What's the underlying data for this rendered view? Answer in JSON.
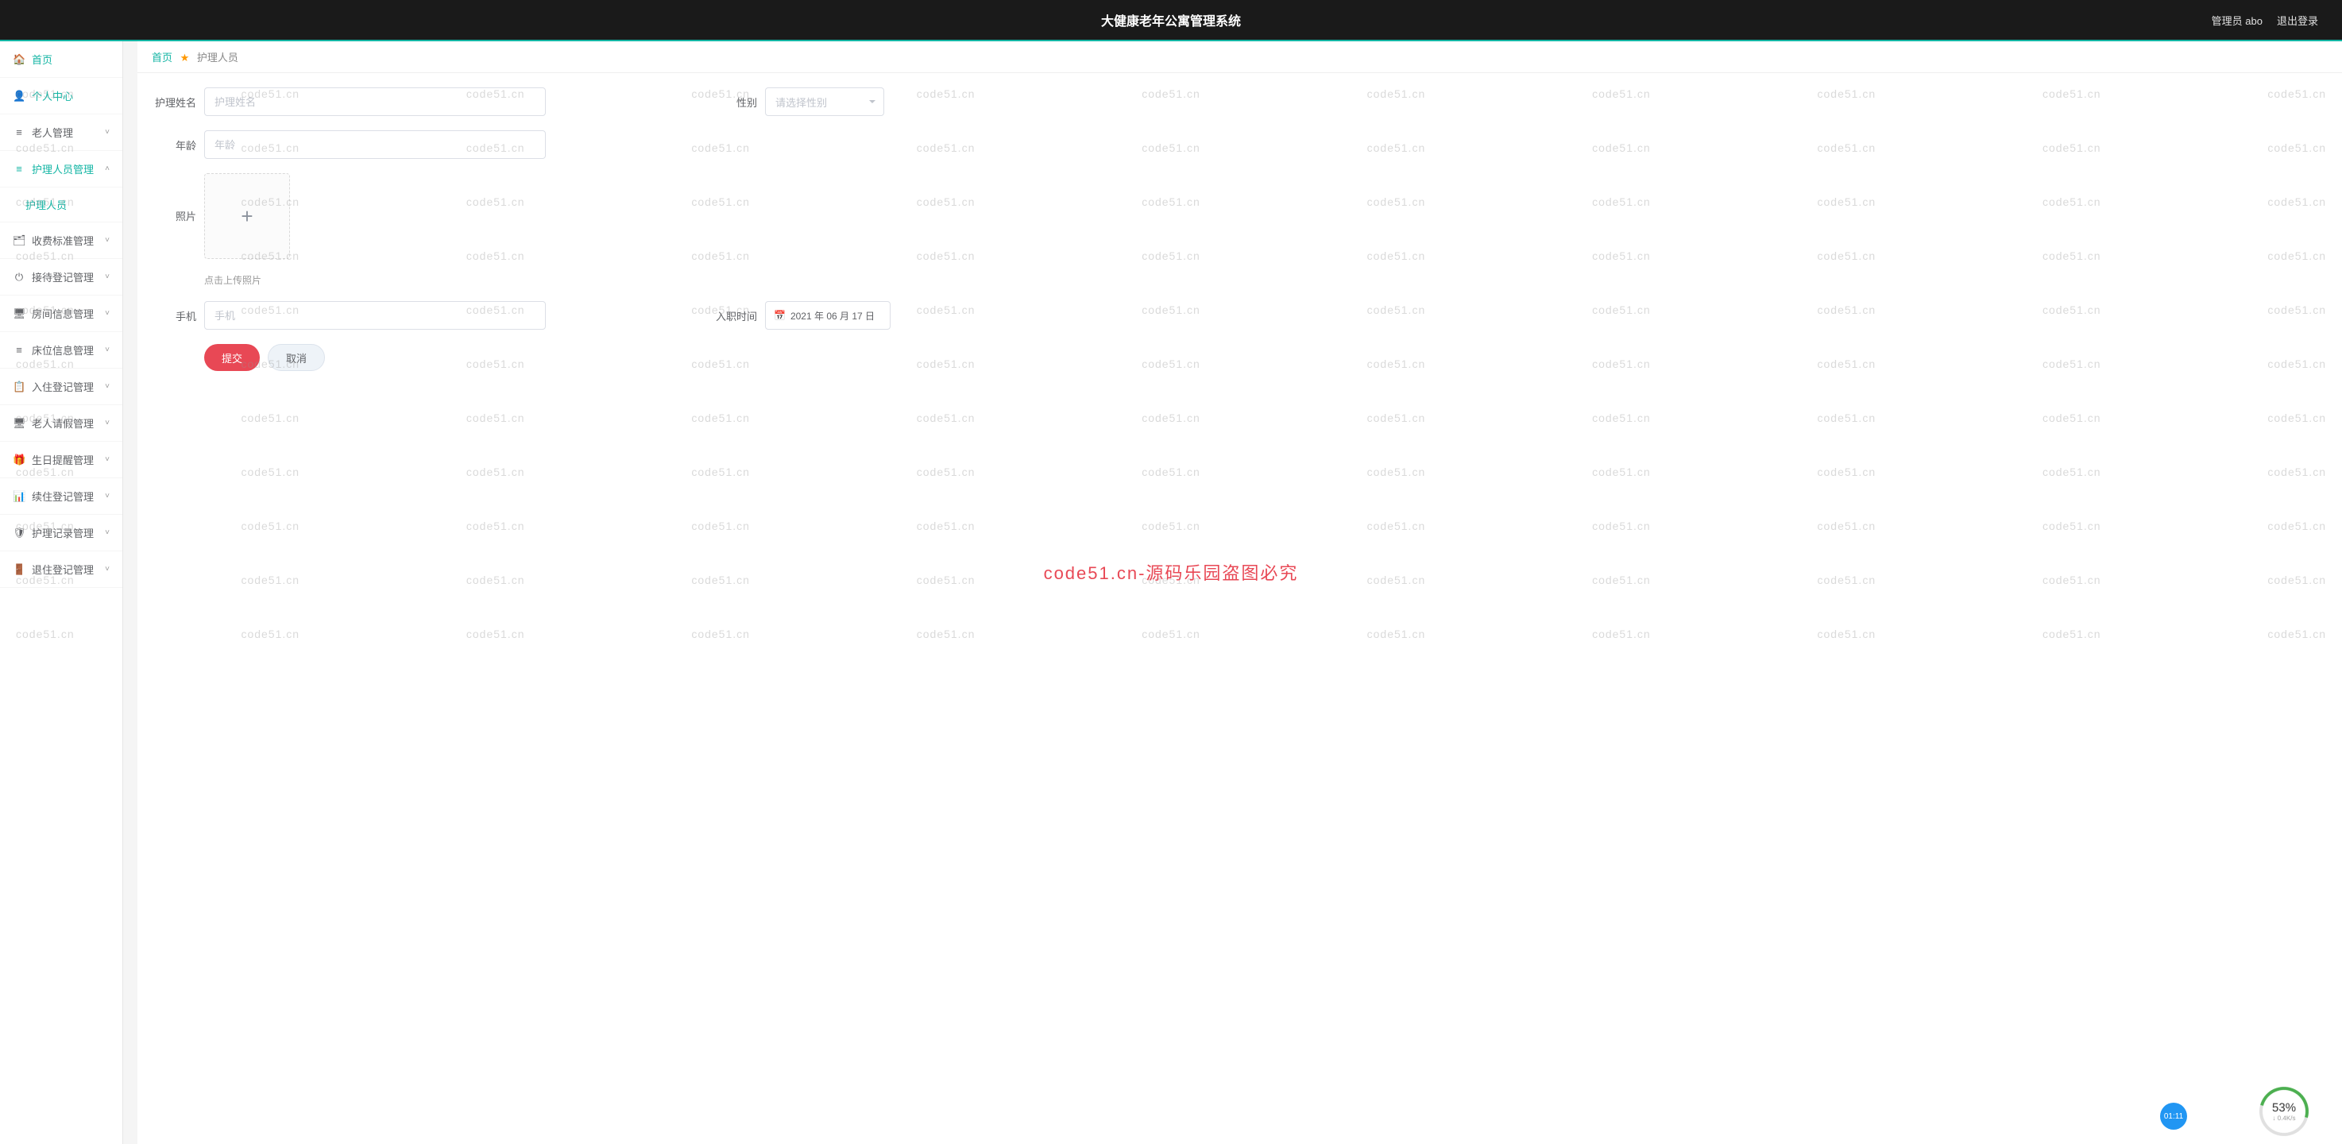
{
  "header": {
    "title": "大健康老年公寓管理系统",
    "admin_label": "管理员 abo",
    "logout_label": "退出登录"
  },
  "sidebar": {
    "items": [
      {
        "icon": "🏠",
        "label": "首页",
        "active": true,
        "expandable": false
      },
      {
        "icon": "👤",
        "label": "个人中心",
        "active": true,
        "expandable": false
      },
      {
        "icon": "≡",
        "label": "老人管理",
        "expandable": true
      },
      {
        "icon": "≡",
        "label": "护理人员管理",
        "active": true,
        "expandable": true,
        "expanded": true,
        "sub": "护理人员"
      },
      {
        "icon": "🗂",
        "label": "收费标准管理",
        "expandable": true
      },
      {
        "icon": "⏻",
        "label": "接待登记管理",
        "expandable": true
      },
      {
        "icon": "🖥",
        "label": "房间信息管理",
        "expandable": true
      },
      {
        "icon": "≡",
        "label": "床位信息管理",
        "expandable": true
      },
      {
        "icon": "📋",
        "label": "入住登记管理",
        "expandable": true
      },
      {
        "icon": "🖥",
        "label": "老人请假管理",
        "expandable": true
      },
      {
        "icon": "🎁",
        "label": "生日提醒管理",
        "expandable": true
      },
      {
        "icon": "📊",
        "label": "续住登记管理",
        "expandable": true
      },
      {
        "icon": "🛡",
        "label": "护理记录管理",
        "expandable": true
      },
      {
        "icon": "🚪",
        "label": "退住登记管理",
        "expandable": true
      }
    ]
  },
  "breadcrumb": {
    "home": "首页",
    "current": "护理人员"
  },
  "form": {
    "name_label": "护理姓名",
    "name_placeholder": "护理姓名",
    "gender_label": "性别",
    "gender_placeholder": "请选择性别",
    "age_label": "年龄",
    "age_placeholder": "年龄",
    "photo_label": "照片",
    "upload_hint": "点击上传照片",
    "phone_label": "手机",
    "phone_placeholder": "手机",
    "hiredate_label": "入职时间",
    "hiredate_value": "2021 年 06 月 17 日",
    "submit_label": "提交",
    "cancel_label": "取消"
  },
  "watermark": {
    "text": "code51.cn",
    "center": "code51.cn-源码乐园盗图必究"
  },
  "widgets": {
    "timer": "01:11",
    "speed_pct": "53%",
    "speed_sub": "↓ 0.4K/s"
  }
}
